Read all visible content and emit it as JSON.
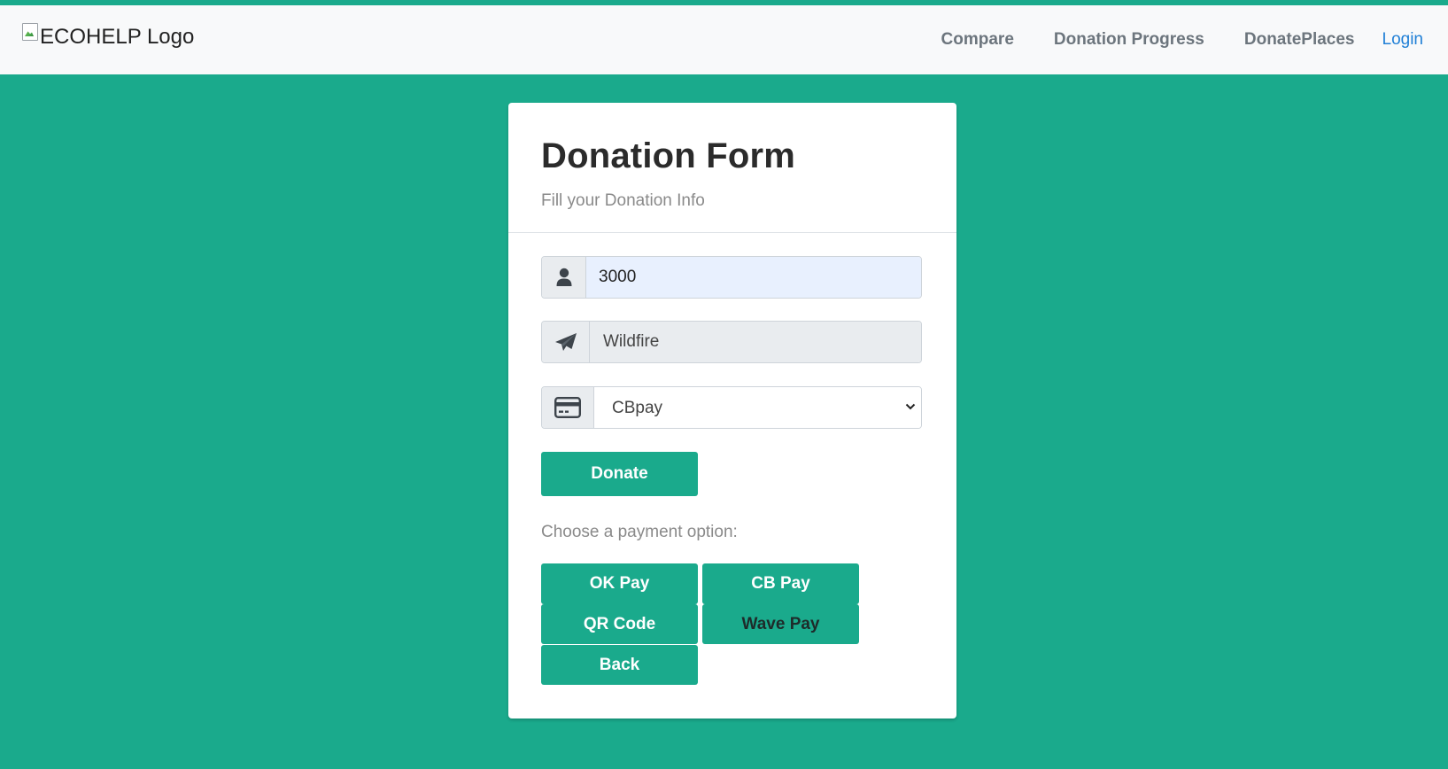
{
  "navbar": {
    "logo_alt": "ECOHELP Logo",
    "links": [
      "Compare",
      "Donation Progress",
      "DonatePlaces"
    ],
    "login": "Login"
  },
  "form": {
    "title": "Donation Form",
    "subtitle": "Fill your Donation Info",
    "amount_value": "3000",
    "amount_icon": "user-icon",
    "cause_value": "Wildfire",
    "cause_icon": "paper-plane-icon",
    "payment_selected": "CBpay",
    "payment_icon": "credit-card-icon",
    "donate_label": "Donate",
    "choose_label": "Choose a payment option:",
    "options": {
      "ok_pay": "OK Pay",
      "cb_pay": "CB Pay",
      "qr_code": "QR Code",
      "wave_pay": "Wave Pay",
      "back": "Back"
    }
  },
  "colors": {
    "accent": "#1aaa8c",
    "navbar_bg": "#f8f9fa",
    "login_link": "#1f7fd6"
  }
}
